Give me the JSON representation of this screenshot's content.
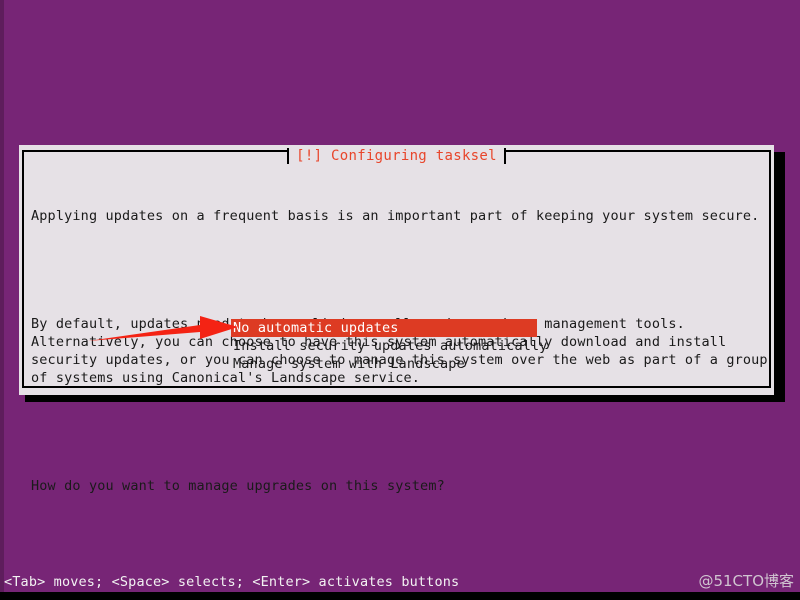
{
  "screen": {
    "background_color": "#772576",
    "left_edge_color": "#5E1D5C",
    "bottom_strip_color": "#000000"
  },
  "dialog": {
    "title": "[!] Configuring tasksel",
    "title_color": "#E8452B",
    "background_color": "#E6E1E6",
    "border_color": "#000000",
    "shadow_color": "#000000",
    "paragraphs": [
      "Applying updates on a frequent basis is an important part of keeping your system secure.",
      "By default, updates need to be applied manually using package management tools.\nAlternatively, you can choose to have this system automatically download and install\nsecurity updates, or you can choose to manage this system over the web as part of a group\nof systems using Canonical's Landscape service.",
      "How do you want to manage upgrades on this system?"
    ],
    "options": [
      {
        "label": "No automatic updates",
        "selected": true
      },
      {
        "label": "Install security updates automatically",
        "selected": false
      },
      {
        "label": "Manage system with Landscape",
        "selected": false
      }
    ],
    "selected_index": 0,
    "highlight_color": "#DD3B23",
    "highlight_text_color": "#FFFFFF"
  },
  "annotation": {
    "arrow_color": "#F42314",
    "arrow_name": "red-pointer-arrow",
    "points_to": "No automatic updates"
  },
  "help_bar": {
    "text": "<Tab> moves; <Space> selects; <Enter> activates buttons",
    "text_color": "#F2F2F2"
  },
  "watermark": {
    "text": "@51CTO博客",
    "color": "#D8D2D8"
  }
}
